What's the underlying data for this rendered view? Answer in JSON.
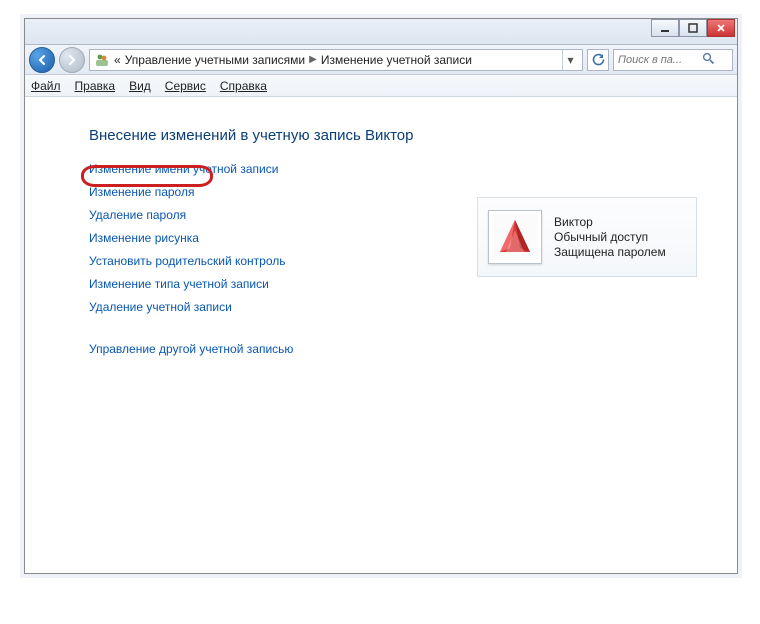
{
  "titlebar": {},
  "address": {
    "chevrons": "«",
    "crumb1": "Управление учетными записями",
    "crumb2": "Изменение учетной записи"
  },
  "search": {
    "placeholder": "Поиск в па..."
  },
  "menu": {
    "file": "Файл",
    "edit": "Правка",
    "view": "Вид",
    "tools": "Сервис",
    "help": "Справка"
  },
  "heading": "Внесение изменений в учетную запись Виктор",
  "links": {
    "rename": "Изменение имени учетной записи",
    "change_pw": "Изменение пароля",
    "remove_pw": "Удаление пароля",
    "change_pic": "Изменение рисунка",
    "parental": "Установить родительский контроль",
    "change_type": "Изменение типа учетной записи",
    "delete": "Удаление учетной записи",
    "manage_other": "Управление другой учетной записью"
  },
  "account": {
    "name": "Виктор",
    "type": "Обычный доступ",
    "status": "Защищена паролем"
  }
}
